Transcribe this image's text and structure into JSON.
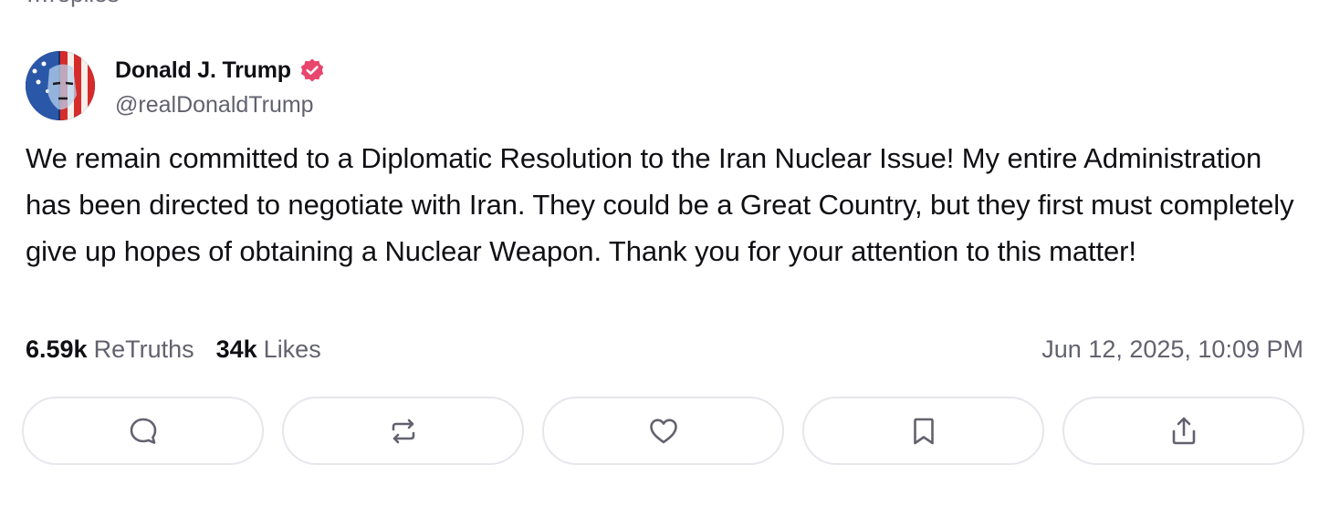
{
  "header_cut_text": "…replies",
  "post": {
    "author_name": "Donald J. Trump",
    "handle": "@realDonaldTrump",
    "verified_icon": "verified-badge-icon",
    "text": "We remain committed to a Diplomatic Resolution to the Iran Nuclear Issue! My entire Administration has been directed to negotiate with Iran. They could be a Great Country, but they first must completely give up hopes of obtaining a Nuclear Weapon. Thank you for your attention to this matter!",
    "retruths_count": "6.59k",
    "retruths_label": "ReTruths",
    "likes_count": "34k",
    "likes_label": "Likes",
    "timestamp": "Jun 12, 2025, 10:09 PM"
  },
  "actions": [
    {
      "name": "reply",
      "icon": "comment-icon"
    },
    {
      "name": "retruth",
      "icon": "repost-icon"
    },
    {
      "name": "like",
      "icon": "heart-icon"
    },
    {
      "name": "bookmark",
      "icon": "bookmark-icon"
    },
    {
      "name": "share",
      "icon": "share-icon"
    }
  ],
  "colors": {
    "verified": "#e8466d",
    "text": "#0f0f14",
    "muted": "#62626f",
    "button_border": "#e6e6ec"
  }
}
